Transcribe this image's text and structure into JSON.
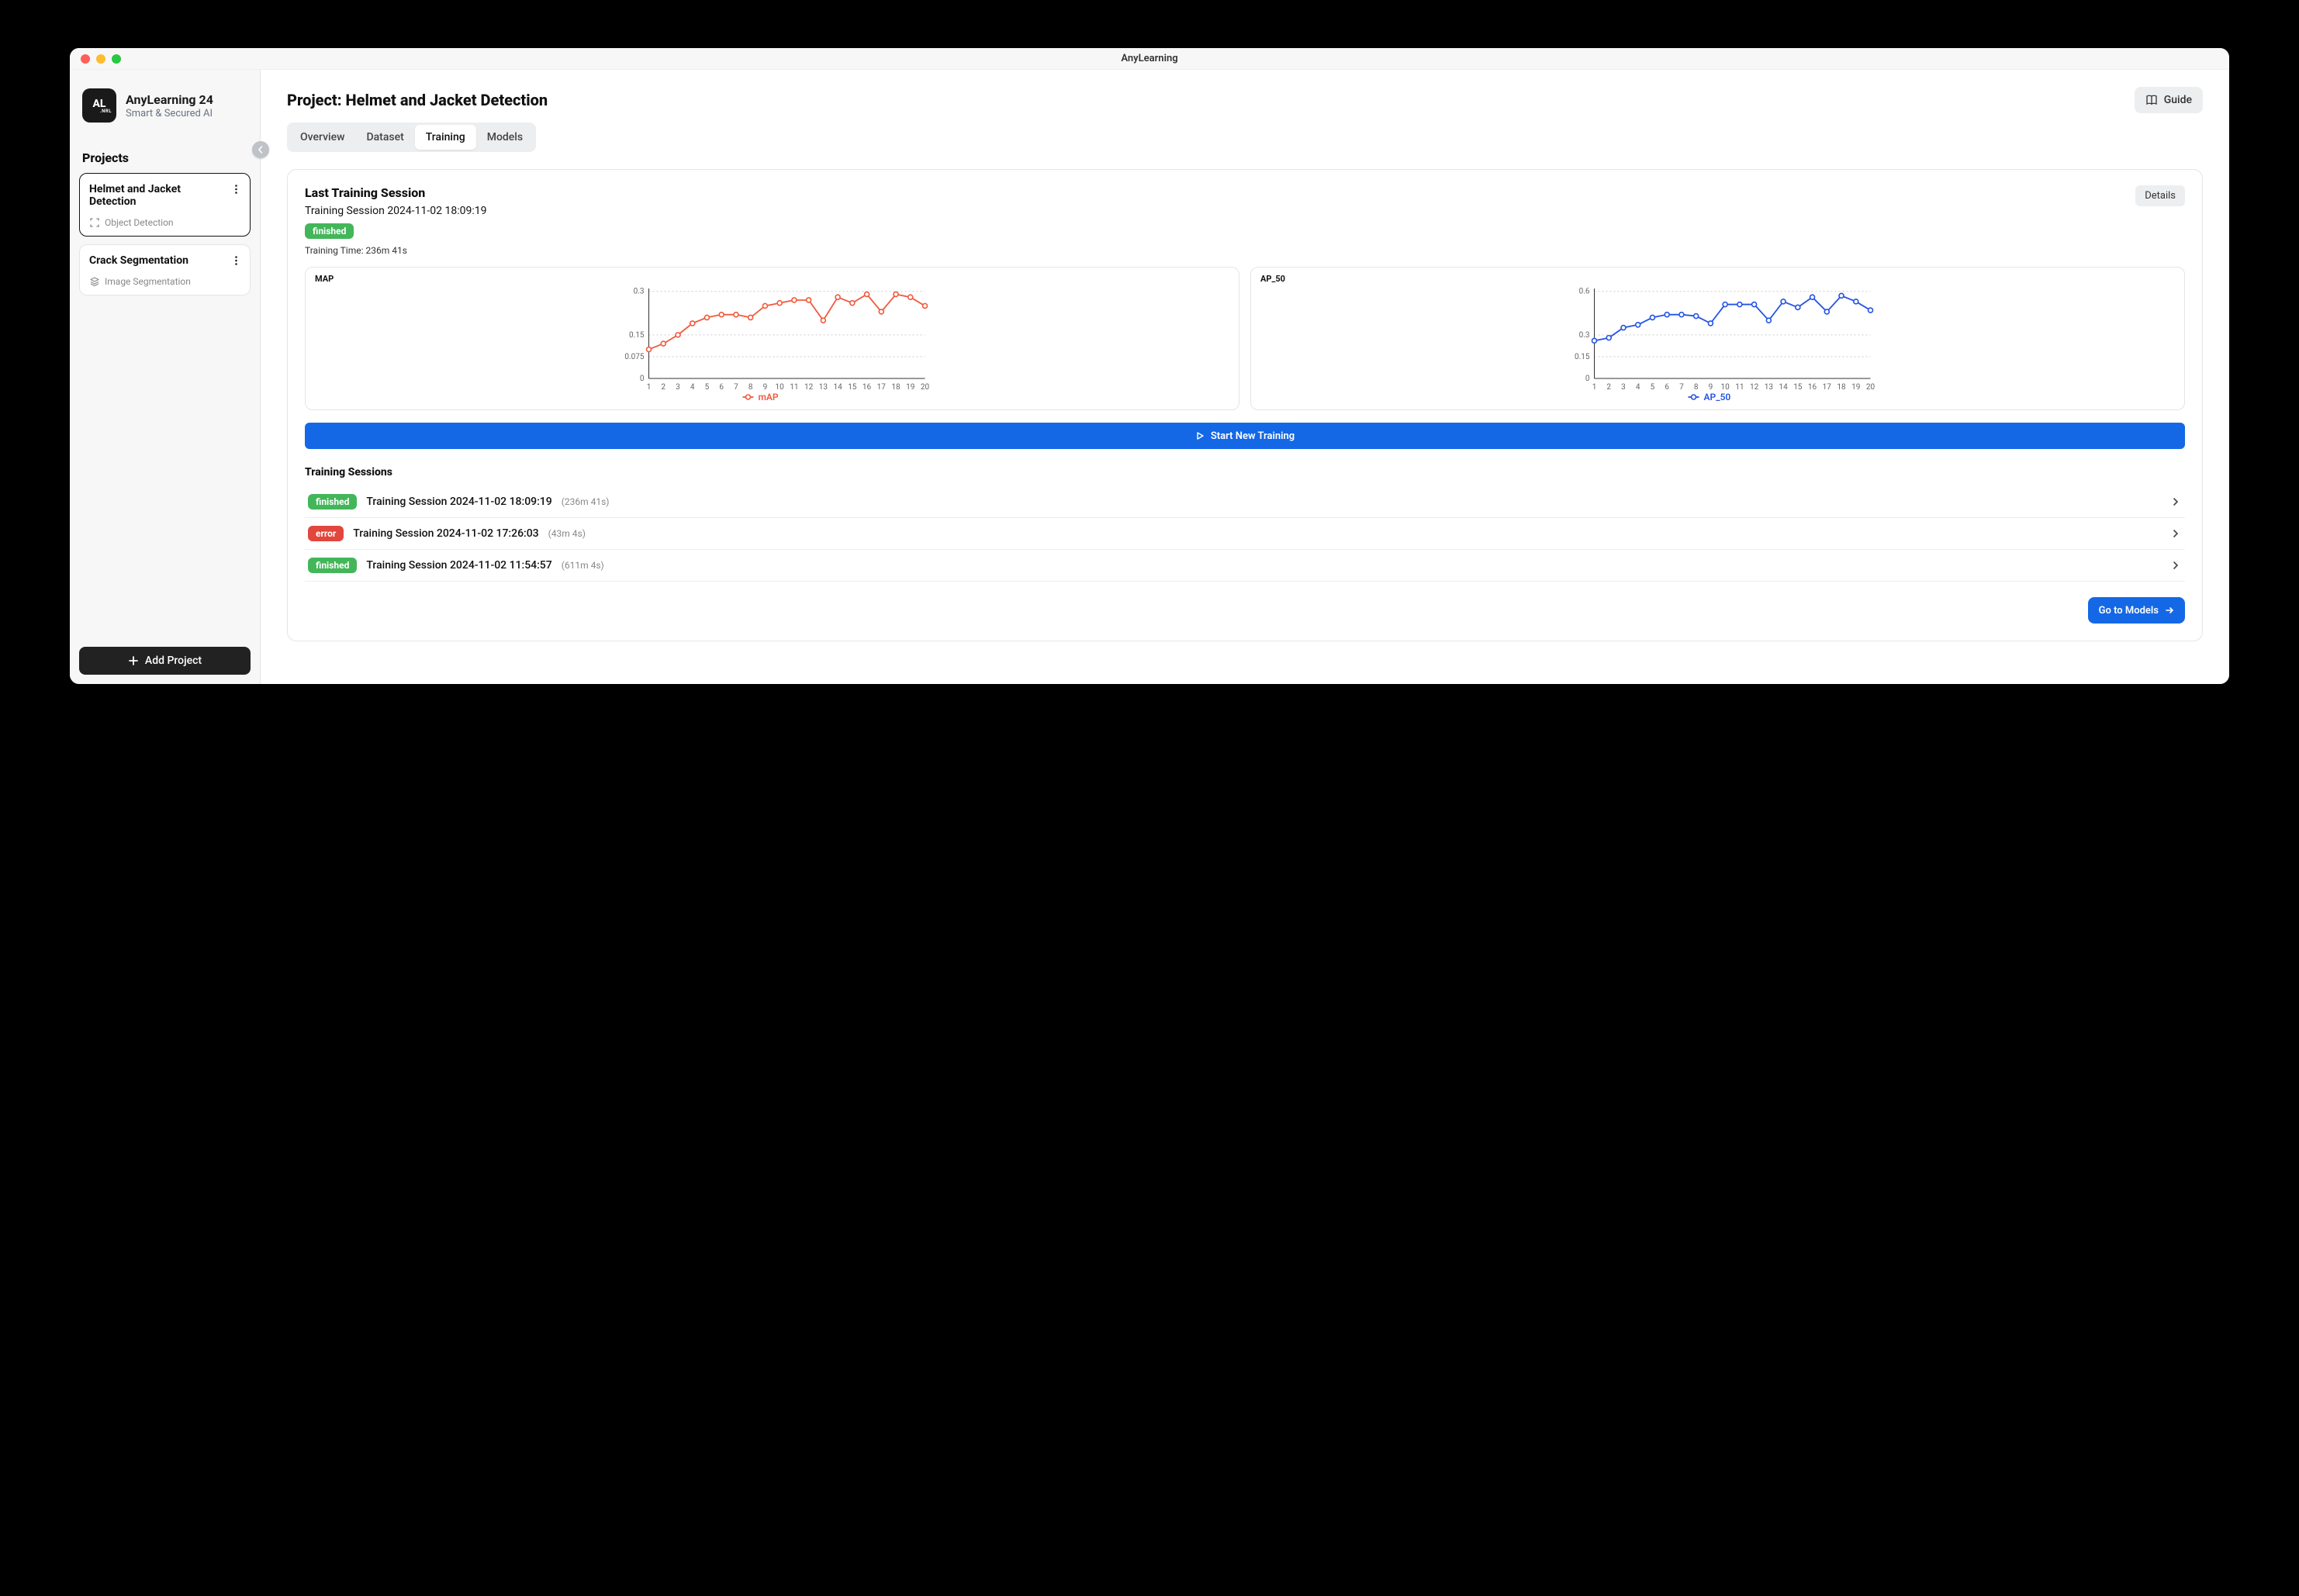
{
  "window": {
    "title": "AnyLearning"
  },
  "brand": {
    "logo_text": "AL",
    "logo_sub": ".NRL",
    "name": "AnyLearning 24",
    "tag": "Smart & Secured AI"
  },
  "sidebar": {
    "heading": "Projects",
    "projects": [
      {
        "title": "Helmet and Jacket Detection",
        "type": "Object Detection",
        "active": true
      },
      {
        "title": "Crack Segmentation",
        "type": "Image Segmentation",
        "active": false
      }
    ],
    "add_label": "Add Project"
  },
  "header": {
    "title": "Project: Helmet and Jacket Detection",
    "guide_label": "Guide"
  },
  "tabs": [
    {
      "label": "Overview",
      "active": false
    },
    {
      "label": "Dataset",
      "active": false
    },
    {
      "label": "Training",
      "active": true
    },
    {
      "label": "Models",
      "active": false
    }
  ],
  "last_session": {
    "title": "Last Training Session",
    "subtitle": "Training Session 2024-11-02 18:09:19",
    "status": "finished",
    "training_time_label": "Training Time: 236m 41s",
    "details_label": "Details"
  },
  "start_training_label": "Start New Training",
  "sessions_heading": "Training Sessions",
  "sessions": [
    {
      "status": "finished",
      "name": "Training Session 2024-11-02 18:09:19",
      "duration": "(236m 41s)"
    },
    {
      "status": "error",
      "name": "Training Session 2024-11-02 17:26:03",
      "duration": "(43m 4s)"
    },
    {
      "status": "finished",
      "name": "Training Session 2024-11-02 11:54:57",
      "duration": "(611m 4s)"
    }
  ],
  "go_models_label": "Go to Models",
  "chart_data": [
    {
      "type": "line",
      "title": "MAP",
      "legend": "mAP",
      "color": "#f05a3c",
      "xlabel": "",
      "ylabel": "",
      "x": [
        1,
        2,
        3,
        4,
        5,
        6,
        7,
        8,
        9,
        10,
        11,
        12,
        13,
        14,
        15,
        16,
        17,
        18,
        19,
        20
      ],
      "y": [
        0.1,
        0.12,
        0.15,
        0.19,
        0.21,
        0.22,
        0.22,
        0.21,
        0.25,
        0.26,
        0.27,
        0.27,
        0.2,
        0.28,
        0.26,
        0.29,
        0.23,
        0.29,
        0.28,
        0.25
      ],
      "y_ticks": [
        0,
        0.075,
        0.15,
        0.3
      ],
      "xlim": [
        1,
        20
      ],
      "ylim": [
        0,
        0.31
      ]
    },
    {
      "type": "line",
      "title": "AP_50",
      "legend": "AP_50",
      "color": "#2454e6",
      "xlabel": "",
      "ylabel": "",
      "x": [
        1,
        2,
        3,
        4,
        5,
        6,
        7,
        8,
        9,
        10,
        11,
        12,
        13,
        14,
        15,
        16,
        17,
        18,
        19,
        20
      ],
      "y": [
        0.26,
        0.28,
        0.35,
        0.37,
        0.42,
        0.44,
        0.44,
        0.43,
        0.38,
        0.51,
        0.51,
        0.51,
        0.4,
        0.53,
        0.49,
        0.56,
        0.46,
        0.57,
        0.53,
        0.47
      ],
      "y_ticks": [
        0,
        0.15,
        0.3,
        0.6
      ],
      "xlim": [
        1,
        20
      ],
      "ylim": [
        0,
        0.62
      ]
    }
  ]
}
